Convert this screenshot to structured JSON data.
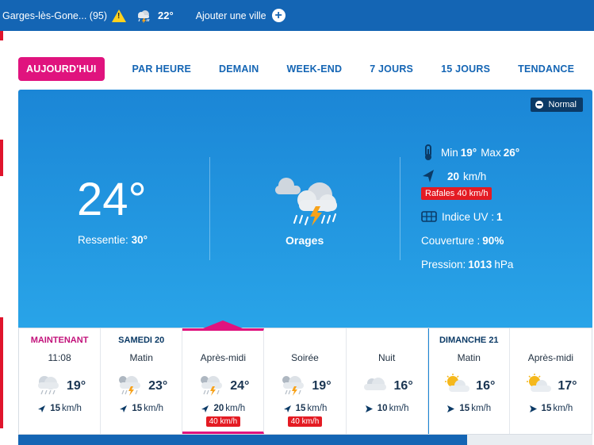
{
  "topbar": {
    "city": "Garges-lès-Gone...",
    "department": "(95)",
    "temp": "22°",
    "add_city": "Ajouter une ville",
    "alert_symbol": "!",
    "plus_symbol": "+"
  },
  "tabs": [
    {
      "label": "AUJOURD'HUI",
      "active": true
    },
    {
      "label": "PAR HEURE"
    },
    {
      "label": "DEMAIN"
    },
    {
      "label": "WEEK-END"
    },
    {
      "label": "7 JOURS"
    },
    {
      "label": "15 JOURS"
    },
    {
      "label": "TENDANCE"
    }
  ],
  "current": {
    "badge": "Normal",
    "temperature": "24°",
    "feels_label": "Ressentie:",
    "feels_value": "30°",
    "condition": "Orages",
    "min_label": "Min",
    "min_value": "19°",
    "max_label": "Max",
    "max_value": "26°",
    "wind_speed": "20",
    "wind_unit": "km/h",
    "gust": "Rafales 40 km/h",
    "uv_label": "Indice UV :",
    "uv_value": "1",
    "cover_label": "Couverture :",
    "cover_value": "90%",
    "pressure_label": "Pression:",
    "pressure_value": "1013",
    "pressure_unit": "hPa"
  },
  "forecast": [
    {
      "day": "MAINTENANT",
      "period": "11:08",
      "temp": "19°",
      "wind": "15",
      "unit": "km/h",
      "gust": "",
      "icon": "cloud-rain-sun-icon"
    },
    {
      "day": "SAMEDI 20",
      "period": "Matin",
      "temp": "23°",
      "wind": "15",
      "unit": "km/h",
      "gust": "",
      "icon": "storm-icon"
    },
    {
      "day": "",
      "period": "Après-midi",
      "temp": "24°",
      "wind": "20",
      "unit": "km/h",
      "gust": "40 km/h",
      "icon": "storm-icon"
    },
    {
      "day": "",
      "period": "Soirée",
      "temp": "19°",
      "wind": "15",
      "unit": "km/h",
      "gust": "40 km/h",
      "icon": "storm-icon"
    },
    {
      "day": "",
      "period": "Nuit",
      "temp": "16°",
      "wind": "10",
      "unit": "km/h",
      "gust": "",
      "icon": "cloud-icon"
    },
    {
      "day": "DIMANCHE 21",
      "period": "Matin",
      "temp": "16°",
      "wind": "15",
      "unit": "km/h",
      "gust": "",
      "icon": "sun-cloud-icon"
    },
    {
      "day": "",
      "period": "Après-midi",
      "temp": "17°",
      "wind": "15",
      "unit": "km/h",
      "gust": "",
      "icon": "sun-cloud-icon"
    }
  ],
  "colors": {
    "brand": "#1465b4",
    "accent": "#e0137e",
    "alert": "#e41b23",
    "warning": "#ffd21e"
  }
}
